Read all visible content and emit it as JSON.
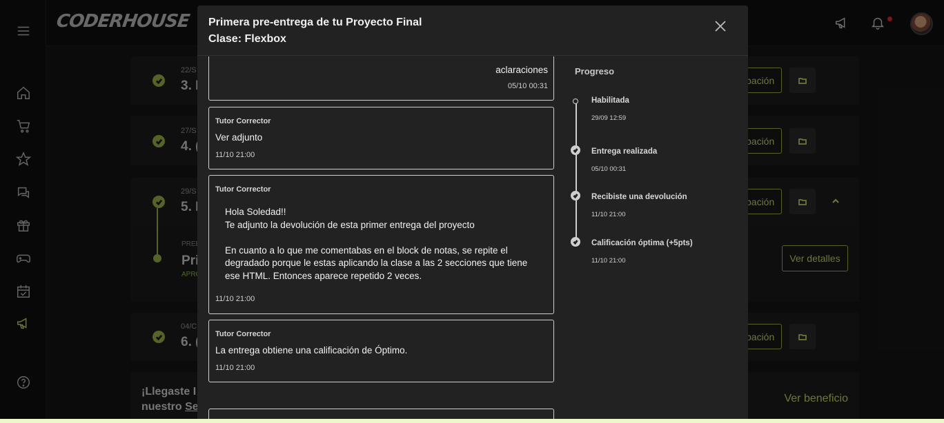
{
  "brand": {
    "logo": "CODERHOUSE"
  },
  "colors": {
    "accent": "#c5d86d",
    "accent_dark": "#9bb34a",
    "bg": "#151515",
    "modal_bg": "#222223",
    "notif": "#e02b2b"
  },
  "sidebar": {
    "items": [
      "menu-icon",
      "home-icon",
      "cart-icon",
      "star-icon",
      "chat-icon",
      "gift-icon",
      "gamepad-icon",
      "calendar-icon",
      "megaphone-icon",
      "help-icon"
    ]
  },
  "background": {
    "cards": [
      {
        "date": "22/S",
        "title": "3. I",
        "btn": "pación"
      },
      {
        "date": "27/S",
        "title": "4. (",
        "btn": "pación"
      },
      {
        "date": "29/S",
        "title": "5. I",
        "btn": "pación"
      },
      {
        "date": "04/C",
        "title": "6. (",
        "btn": "pación"
      }
    ],
    "sub": {
      "kicker": "PREE",
      "title": "Pri",
      "status": "APRO",
      "details": "Ver detalles"
    },
    "benefit": {
      "line1": "¡Llegaste I",
      "line2_pre": "nuestro ",
      "line2_link": "Se",
      "cta": "Ver beneficio"
    }
  },
  "modal": {
    "title_line1": "Primera pre-entrega de tu Proyecto Final",
    "title_line2": "Clase: Flexbox",
    "messages": [
      {
        "author": "",
        "body": "aclaraciones",
        "time": "05/10 00:31"
      },
      {
        "author": "Tutor Corrector",
        "body": "Ver adjunto",
        "time": "11/10 21:00"
      },
      {
        "author": "Tutor Corrector",
        "body_lines": [
          "Hola Soledad!!",
          "Te adjunto la devolución de esta primer entrega del proyecto",
          "",
          "En cuanto a lo que me comentabas en el block de notas, se repite el",
          "degradado porque le estas aplicando la clase a las 2 secciones que tiene",
          "ese HTML. Entonces aparece repetido 2 veces."
        ],
        "time": "11/10 21:00"
      },
      {
        "author": "Tutor Corrector",
        "body": "La entrega obtiene una calificación de Óptimo.",
        "time": "11/10 21:00"
      }
    ],
    "progress": {
      "title": "Progreso",
      "steps": [
        {
          "label": "Habilitada",
          "time": "29/09 12:59"
        },
        {
          "label": "Entrega realizada",
          "time": "05/10 00:31"
        },
        {
          "label": "Recibiste una devolución",
          "time": "11/10 21:00"
        },
        {
          "label": "Calificación óptima (+5pts)",
          "time": "11/10 21:00"
        }
      ]
    }
  }
}
